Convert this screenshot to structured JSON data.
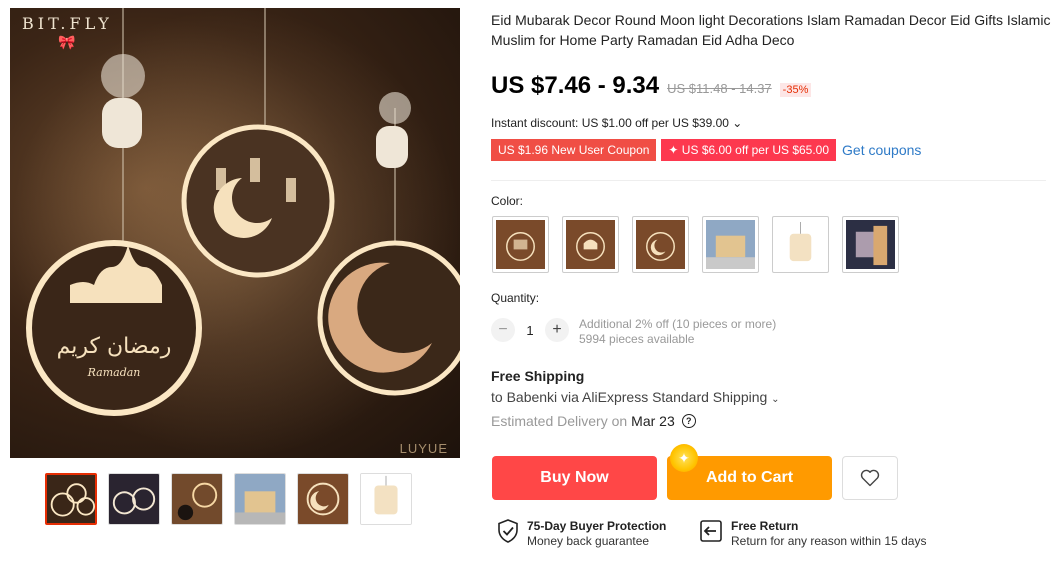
{
  "gallery": {
    "brand": "BIT.FLY",
    "watermark": "LUYUE"
  },
  "product": {
    "title": "Eid Mubarak Decor Round Moon light Decorations Islam Ramadan Decor Eid Gifts Islamic Muslim for Home Party Ramadan Eid Adha Deco",
    "price": "US $7.46 - 9.34",
    "old_price": "US $11.48 - 14.37",
    "discount": "-35%",
    "instant_discount": "Instant discount: US $1.00 off per US $39.00 ⌄"
  },
  "coupons": {
    "new_user": "US $1.96 New User Coupon",
    "store": "✦ US $6.00 off per US $65.00",
    "get_link": "Get coupons"
  },
  "color": {
    "label": "Color:"
  },
  "quantity": {
    "label": "Quantity:",
    "minus": "−",
    "value": "1",
    "plus": "+",
    "additional": "Additional 2% off (10 pieces or more)",
    "available": "5994 pieces available"
  },
  "shipping": {
    "title": "Free Shipping",
    "to": "to Babenki via AliExpress Standard Shipping",
    "chevron": "⌄",
    "estimated_label": "Estimated Delivery on",
    "date": "Mar 23",
    "help": "?"
  },
  "actions": {
    "buy_now": "Buy Now",
    "add_to_cart": "Add to Cart"
  },
  "protection": {
    "buyer_title": "75-Day Buyer Protection",
    "buyer_sub": "Money back guarantee",
    "return_title": "Free Return",
    "return_sub": "Return for any reason within 15 days"
  },
  "colors": {
    "primary_red": "#ff4747",
    "orange": "#ff9a00",
    "link": "#2e7ac7"
  }
}
